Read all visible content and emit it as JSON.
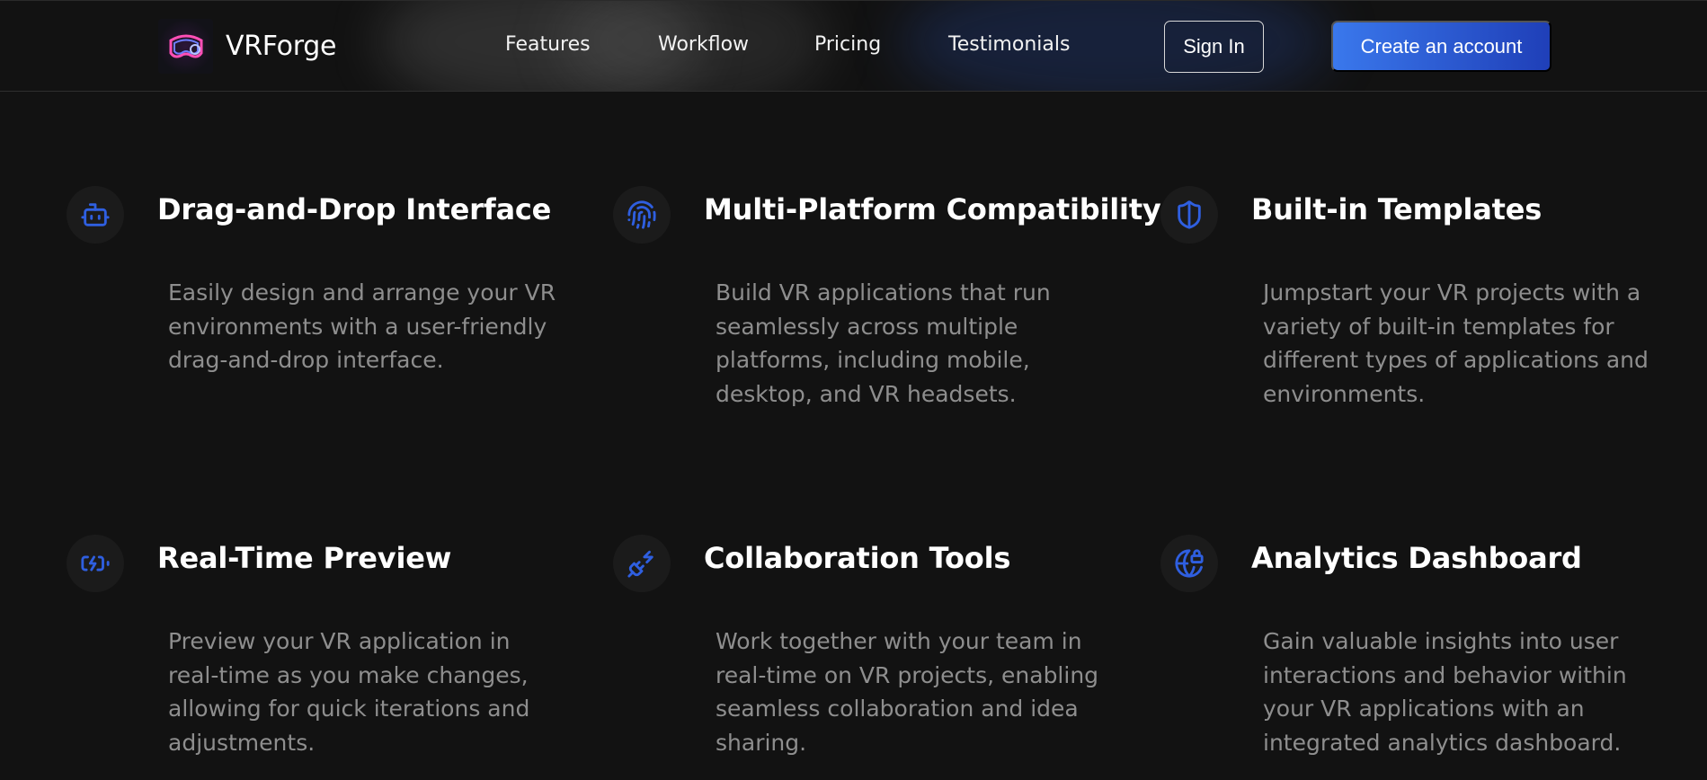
{
  "brand": {
    "name": "VRForge",
    "logo_icon": "vr-headset-icon"
  },
  "nav": {
    "links": [
      "Features",
      "Workflow",
      "Pricing",
      "Testimonials"
    ],
    "sign_in": "Sign In",
    "create_account": "Create an account"
  },
  "features": [
    {
      "title": "Drag-and-Drop Interface",
      "icon": "robot-icon",
      "description": "Easily design and arrange your VR environments with a user-friendly drag-and-drop interface."
    },
    {
      "title": "Multi-Platform Compatibility",
      "icon": "fingerprint-icon",
      "description": "Build VR applications that run seamlessly across multiple platforms, including mobile, desktop, and VR headsets."
    },
    {
      "title": "Built-in Templates",
      "icon": "shield-icon",
      "description": "Jumpstart your VR projects with a variety of built-in templates for different types of applications and environments."
    },
    {
      "title": "Real-Time Preview",
      "icon": "battery-charging-icon",
      "description": "Preview your VR application in real-time as you make changes, allowing for quick iterations and adjustments."
    },
    {
      "title": "Collaboration Tools",
      "icon": "plug-zap-icon",
      "description": "Work together with your team in real-time on VR projects, enabling seamless collaboration and idea sharing."
    },
    {
      "title": "Analytics Dashboard",
      "icon": "globe-lock-icon",
      "description": "Gain valuable insights into user interactions and behavior within your VR applications with an integrated analytics dashboard."
    }
  ],
  "colors": {
    "accent": "#2f5fe0",
    "background": "#121212",
    "muted_text": "#8e8e8e"
  }
}
